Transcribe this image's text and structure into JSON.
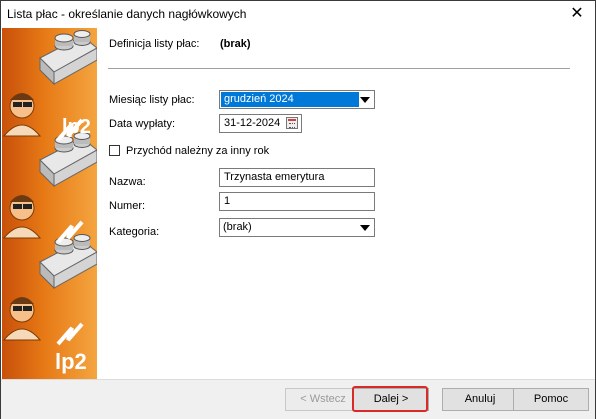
{
  "window": {
    "title": "Lista płac - określanie danych nagłówkowych"
  },
  "sidebar": {
    "brand": "lp2"
  },
  "form": {
    "definition_label": "Definicja listy płac:",
    "definition_value": "(brak)",
    "month_label": "Miesiąc listy płac:",
    "month_value": "grudzień 2024",
    "payout_date_label": "Data wypłaty:",
    "payout_date_value": "31-12-2024",
    "other_year_label": "Przychód należny za inny rok",
    "other_year_checked": false,
    "name_label": "Nazwa:",
    "name_value": "Trzynasta emerytura",
    "number_label": "Numer:",
    "number_value": "1",
    "category_label": "Kategoria:",
    "category_value": "(brak)"
  },
  "buttons": {
    "back": "< Wstecz",
    "next": "Dalej >",
    "cancel": "Anuluj",
    "help": "Pomoc"
  },
  "colors": {
    "sidebar_orange": "#e77a16",
    "selection_blue": "#0078d7",
    "highlight_red": "#d92a2a"
  }
}
